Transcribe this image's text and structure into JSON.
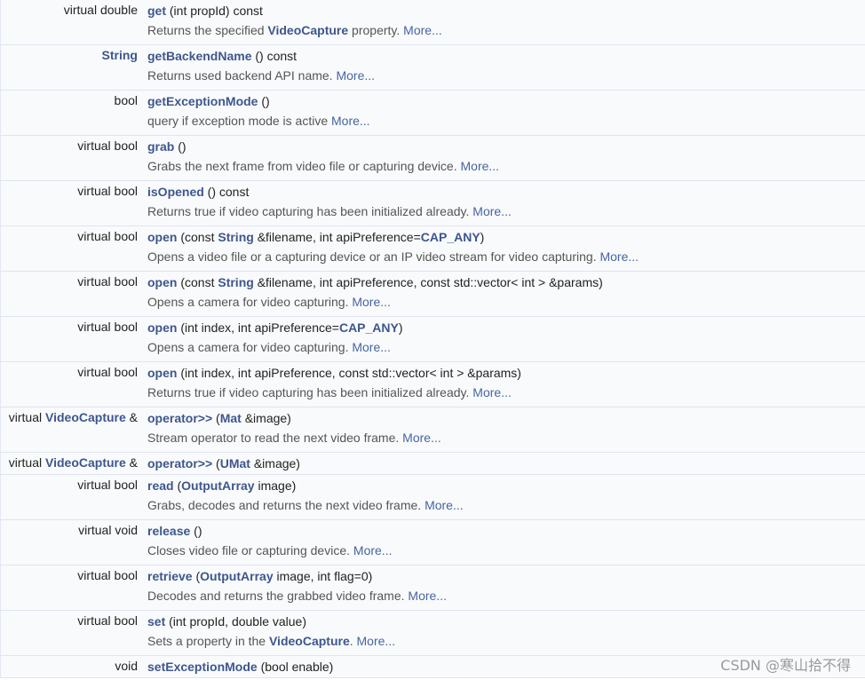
{
  "members": [
    {
      "ret": [
        {
          "t": "virtual double",
          "k": false
        }
      ],
      "sig": [
        {
          "t": "get",
          "k": true
        },
        {
          "t": " (int propId) const",
          "k": false
        }
      ],
      "desc": [
        {
          "t": "Returns the specified ",
          "k": false
        },
        {
          "t": "VideoCapture",
          "k": true
        },
        {
          "t": " property. ",
          "k": false
        }
      ],
      "more": "More..."
    },
    {
      "ret": [
        {
          "t": "String",
          "k": true
        }
      ],
      "sig": [
        {
          "t": "getBackendName",
          "k": true
        },
        {
          "t": " () const",
          "k": false
        }
      ],
      "desc": [
        {
          "t": "Returns used backend API name. ",
          "k": false
        }
      ],
      "more": "More..."
    },
    {
      "ret": [
        {
          "t": "bool",
          "k": false
        }
      ],
      "sig": [
        {
          "t": "getExceptionMode",
          "k": true
        },
        {
          "t": " ()",
          "k": false
        }
      ],
      "desc": [
        {
          "t": "query if exception mode is active ",
          "k": false
        }
      ],
      "more": "More..."
    },
    {
      "ret": [
        {
          "t": "virtual bool",
          "k": false
        }
      ],
      "sig": [
        {
          "t": "grab",
          "k": true
        },
        {
          "t": " ()",
          "k": false
        }
      ],
      "desc": [
        {
          "t": "Grabs the next frame from video file or capturing device. ",
          "k": false
        }
      ],
      "more": "More..."
    },
    {
      "ret": [
        {
          "t": "virtual bool",
          "k": false
        }
      ],
      "sig": [
        {
          "t": "isOpened",
          "k": true
        },
        {
          "t": " () const",
          "k": false
        }
      ],
      "desc": [
        {
          "t": "Returns true if video capturing has been initialized already. ",
          "k": false
        }
      ],
      "more": "More..."
    },
    {
      "ret": [
        {
          "t": "virtual bool",
          "k": false
        }
      ],
      "sig": [
        {
          "t": "open",
          "k": true
        },
        {
          "t": " (const ",
          "k": false
        },
        {
          "t": "String",
          "k": true
        },
        {
          "t": " &filename, int apiPreference=",
          "k": false
        },
        {
          "t": "CAP_ANY",
          "k": true
        },
        {
          "t": ")",
          "k": false
        }
      ],
      "desc": [
        {
          "t": "Opens a video file or a capturing device or an IP video stream for video capturing. ",
          "k": false
        }
      ],
      "more": "More..."
    },
    {
      "ret": [
        {
          "t": "virtual bool",
          "k": false
        }
      ],
      "sig": [
        {
          "t": "open",
          "k": true
        },
        {
          "t": " (const ",
          "k": false
        },
        {
          "t": "String",
          "k": true
        },
        {
          "t": " &filename, int apiPreference, const std::vector< int > &params)",
          "k": false
        }
      ],
      "desc": [
        {
          "t": "Opens a camera for video capturing. ",
          "k": false
        }
      ],
      "more": "More..."
    },
    {
      "ret": [
        {
          "t": "virtual bool",
          "k": false
        }
      ],
      "sig": [
        {
          "t": "open",
          "k": true
        },
        {
          "t": " (int index, int apiPreference=",
          "k": false
        },
        {
          "t": "CAP_ANY",
          "k": true
        },
        {
          "t": ")",
          "k": false
        }
      ],
      "desc": [
        {
          "t": "Opens a camera for video capturing. ",
          "k": false
        }
      ],
      "more": "More..."
    },
    {
      "ret": [
        {
          "t": "virtual bool",
          "k": false
        }
      ],
      "sig": [
        {
          "t": "open",
          "k": true
        },
        {
          "t": " (int index, int apiPreference, const std::vector< int > &params)",
          "k": false
        }
      ],
      "desc": [
        {
          "t": "Returns true if video capturing has been initialized already. ",
          "k": false
        }
      ],
      "more": "More..."
    },
    {
      "ret": [
        {
          "t": "virtual ",
          "k": false
        },
        {
          "t": "VideoCapture",
          "k": true
        },
        {
          "t": " &",
          "k": false
        }
      ],
      "sig": [
        {
          "t": "operator>>",
          "k": true
        },
        {
          "t": " (",
          "k": false
        },
        {
          "t": "Mat",
          "k": true
        },
        {
          "t": " &image)",
          "k": false
        }
      ],
      "desc": [
        {
          "t": "Stream operator to read the next video frame. ",
          "k": false
        }
      ],
      "more": "More..."
    },
    {
      "ret": [
        {
          "t": "virtual ",
          "k": false
        },
        {
          "t": "VideoCapture",
          "k": true
        },
        {
          "t": " &",
          "k": false
        }
      ],
      "sig": [
        {
          "t": "operator>>",
          "k": true
        },
        {
          "t": " (",
          "k": false
        },
        {
          "t": "UMat",
          "k": true
        },
        {
          "t": " &image)",
          "k": false
        }
      ],
      "desc": [],
      "more": ""
    },
    {
      "ret": [
        {
          "t": "virtual bool",
          "k": false
        }
      ],
      "sig": [
        {
          "t": "read",
          "k": true
        },
        {
          "t": " (",
          "k": false
        },
        {
          "t": "OutputArray",
          "k": true
        },
        {
          "t": " image)",
          "k": false
        }
      ],
      "desc": [
        {
          "t": "Grabs, decodes and returns the next video frame. ",
          "k": false
        }
      ],
      "more": "More..."
    },
    {
      "ret": [
        {
          "t": "virtual void",
          "k": false
        }
      ],
      "sig": [
        {
          "t": "release",
          "k": true
        },
        {
          "t": " ()",
          "k": false
        }
      ],
      "desc": [
        {
          "t": "Closes video file or capturing device. ",
          "k": false
        }
      ],
      "more": "More..."
    },
    {
      "ret": [
        {
          "t": "virtual bool",
          "k": false
        }
      ],
      "sig": [
        {
          "t": "retrieve",
          "k": true
        },
        {
          "t": " (",
          "k": false
        },
        {
          "t": "OutputArray",
          "k": true
        },
        {
          "t": " image, int flag=0)",
          "k": false
        }
      ],
      "desc": [
        {
          "t": "Decodes and returns the grabbed video frame. ",
          "k": false
        }
      ],
      "more": "More..."
    },
    {
      "ret": [
        {
          "t": "virtual bool",
          "k": false
        }
      ],
      "sig": [
        {
          "t": "set",
          "k": true
        },
        {
          "t": " (int propId, double value)",
          "k": false
        }
      ],
      "desc": [
        {
          "t": "Sets a property in the ",
          "k": false
        },
        {
          "t": "VideoCapture",
          "k": true
        },
        {
          "t": ". ",
          "k": false
        }
      ],
      "more": "More..."
    },
    {
      "ret": [
        {
          "t": "void",
          "k": false
        }
      ],
      "sig": [
        {
          "t": "setExceptionMode",
          "k": true
        },
        {
          "t": " (bool enable)",
          "k": false
        }
      ],
      "desc": [],
      "more": ""
    }
  ],
  "watermark": "CSDN @寒山拾不得",
  "colors": {
    "keyword": "#3d578c",
    "more_link": "#4665a2",
    "row_bg": "#f9fafc",
    "separator": "#dee4f0"
  }
}
